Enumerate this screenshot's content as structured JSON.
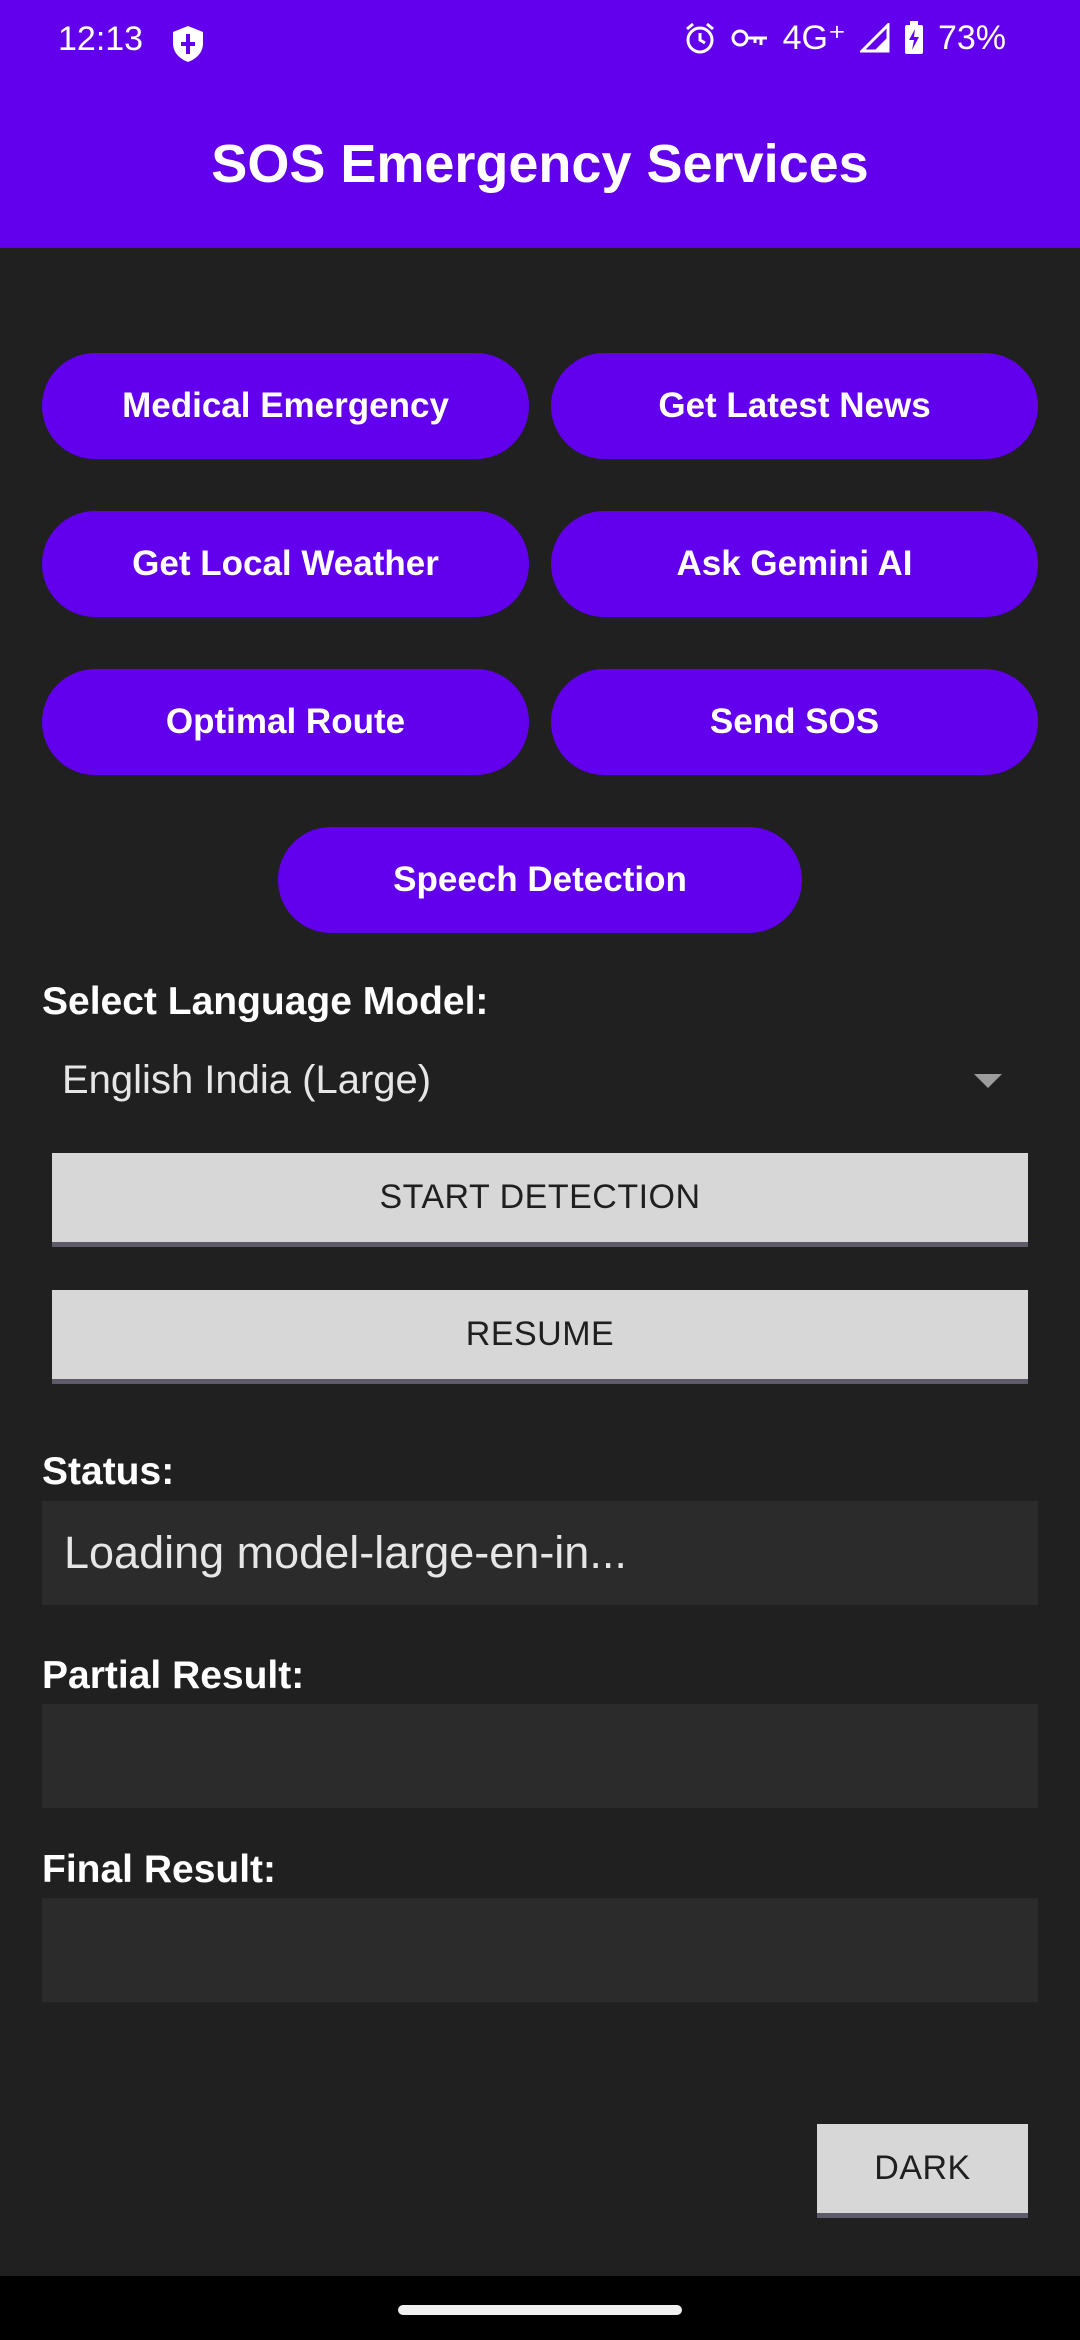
{
  "status_bar": {
    "time": "12:13",
    "network": "4G⁺",
    "battery": "73%",
    "icons": [
      "shield-icon",
      "alarm-icon",
      "vpn-key-icon",
      "signal-icon",
      "battery-charging-icon"
    ]
  },
  "app_bar": {
    "title": "SOS Emergency Services",
    "color": "#6200ee"
  },
  "actions": {
    "medical": "Medical Emergency",
    "news": "Get Latest News",
    "weather": "Get Local Weather",
    "gemini": "Ask Gemini AI",
    "route": "Optimal Route",
    "sos": "Send SOS",
    "speech": "Speech Detection"
  },
  "language": {
    "label": "Select Language Model:",
    "selected": "English India (Large)"
  },
  "controls": {
    "start": "START DETECTION",
    "resume": "RESUME",
    "theme": "DARK"
  },
  "status": {
    "label": "Status:",
    "value": "Loading model-large-en-in..."
  },
  "partial": {
    "label": "Partial Result:",
    "value": ""
  },
  "final": {
    "label": "Final Result:",
    "value": ""
  }
}
